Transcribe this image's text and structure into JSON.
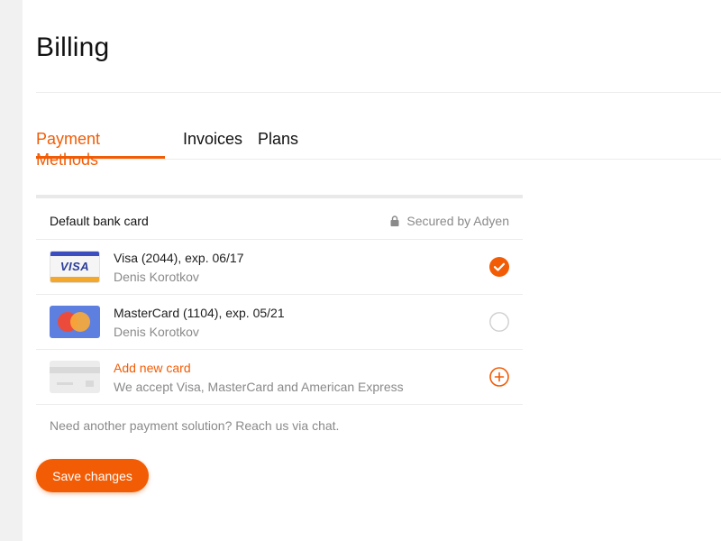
{
  "page": {
    "title": "Billing"
  },
  "tabs": [
    {
      "label": "Payment Methods",
      "active": true
    },
    {
      "label": "Invoices",
      "active": false
    },
    {
      "label": "Plans",
      "active": false
    }
  ],
  "cards_panel": {
    "header_title": "Default bank card",
    "secured_text": "Secured by Adyen",
    "rows": [
      {
        "title": "Visa (2044), exp. 06/17",
        "subtitle": "Denis Korotkov",
        "brand": "VISA",
        "selected": true,
        "control_icon": "check-circle-icon"
      },
      {
        "title": "MasterCard (1104), exp. 05/21",
        "subtitle": "Denis Korotkov",
        "brand": "mastercard",
        "selected": false,
        "control_icon": "radio-empty-icon"
      },
      {
        "title": "Add new card",
        "subtitle": "We accept Visa, MasterCard and American Express",
        "brand": "generic-card",
        "control_icon": "plus-circle-icon"
      }
    ]
  },
  "footer_note": "Need another payment solution? Reach us via chat.",
  "actions": {
    "save_label": "Save changes"
  },
  "colors": {
    "accent": "#f25c05",
    "muted_text": "#8a8a8a",
    "divider": "#ececec"
  }
}
